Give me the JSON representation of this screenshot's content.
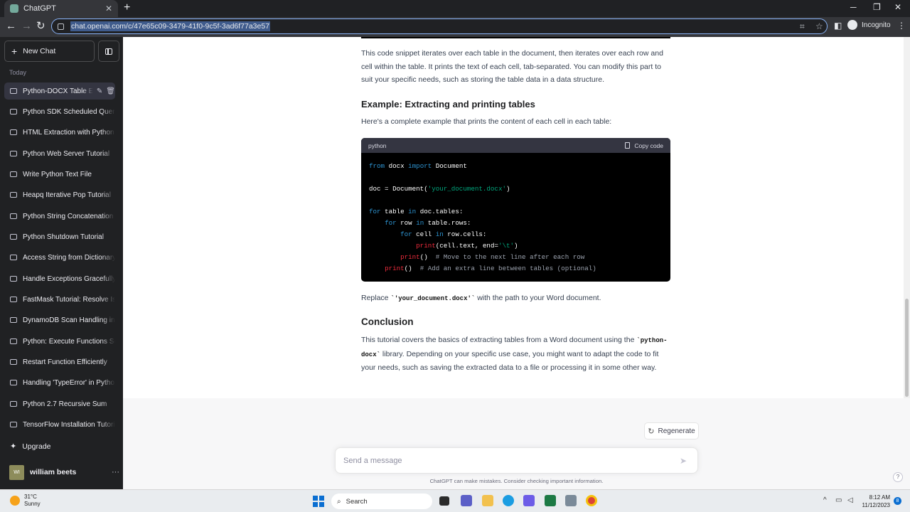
{
  "browser": {
    "tab_title": "ChatGPT",
    "url": "chat.openai.com/c/47e65c09-3479-41f0-9c5f-3ad6f77a3e57",
    "incognito_label": "Incognito"
  },
  "sidebar": {
    "new_chat": "New Chat",
    "section_label": "Today",
    "conversations": [
      "Python-DOCX Table Extraction",
      "Python SDK Scheduled Queries",
      "HTML Extraction with Python",
      "Python Web Server Tutorial",
      "Write Python Text File",
      "Heapq Iterative Pop Tutorial",
      "Python String Concatenation",
      "Python Shutdown Tutorial",
      "Access String from Dictionary",
      "Handle Exceptions Gracefully",
      "FastMask Tutorial: Resolve Issues",
      "DynamoDB Scan Handling in Python",
      "Python: Execute Functions Sequentially",
      "Restart Function Efficiently",
      "Handling 'TypeError' in Python",
      "Python 2.7 Recursive Sum",
      "TensorFlow Installation Tutorial"
    ],
    "upgrade": "Upgrade",
    "user_initials": "WI",
    "user_name": "william beets"
  },
  "content": {
    "intro_para": "This code snippet iterates over each table in the document, then iterates over each row and cell within the table. It prints the text of each cell, tab-separated. You can modify this part to suit your specific needs, such as storing the table data in a data structure.",
    "example_heading": "Example: Extracting and printing tables",
    "example_intro": "Here's a complete example that prints the content of each cell in each table:",
    "code_lang": "python",
    "copy_label": "Copy code",
    "replace_pre": "Replace ",
    "replace_code": "`'your_document.docx'`",
    "replace_post": " with the path to your Word document.",
    "conclusion_heading": "Conclusion",
    "conclusion_pre": "This tutorial covers the basics of extracting tables from a Word document using the ",
    "conclusion_code": "`python-docx`",
    "conclusion_post": " library. Depending on your specific use case, you might want to adapt the code to fit your needs, such as saving the extracted data to a file or processing it in some other way."
  },
  "composer": {
    "regenerate": "Regenerate",
    "placeholder": "Send a message",
    "disclaimer": "ChatGPT can make mistakes. Consider checking important information.",
    "help": "?"
  },
  "taskbar": {
    "temperature": "31°C",
    "condition": "Sunny",
    "search": "Search",
    "time": "8:12 AM",
    "date": "11/12/2023",
    "notification_count": "8"
  }
}
